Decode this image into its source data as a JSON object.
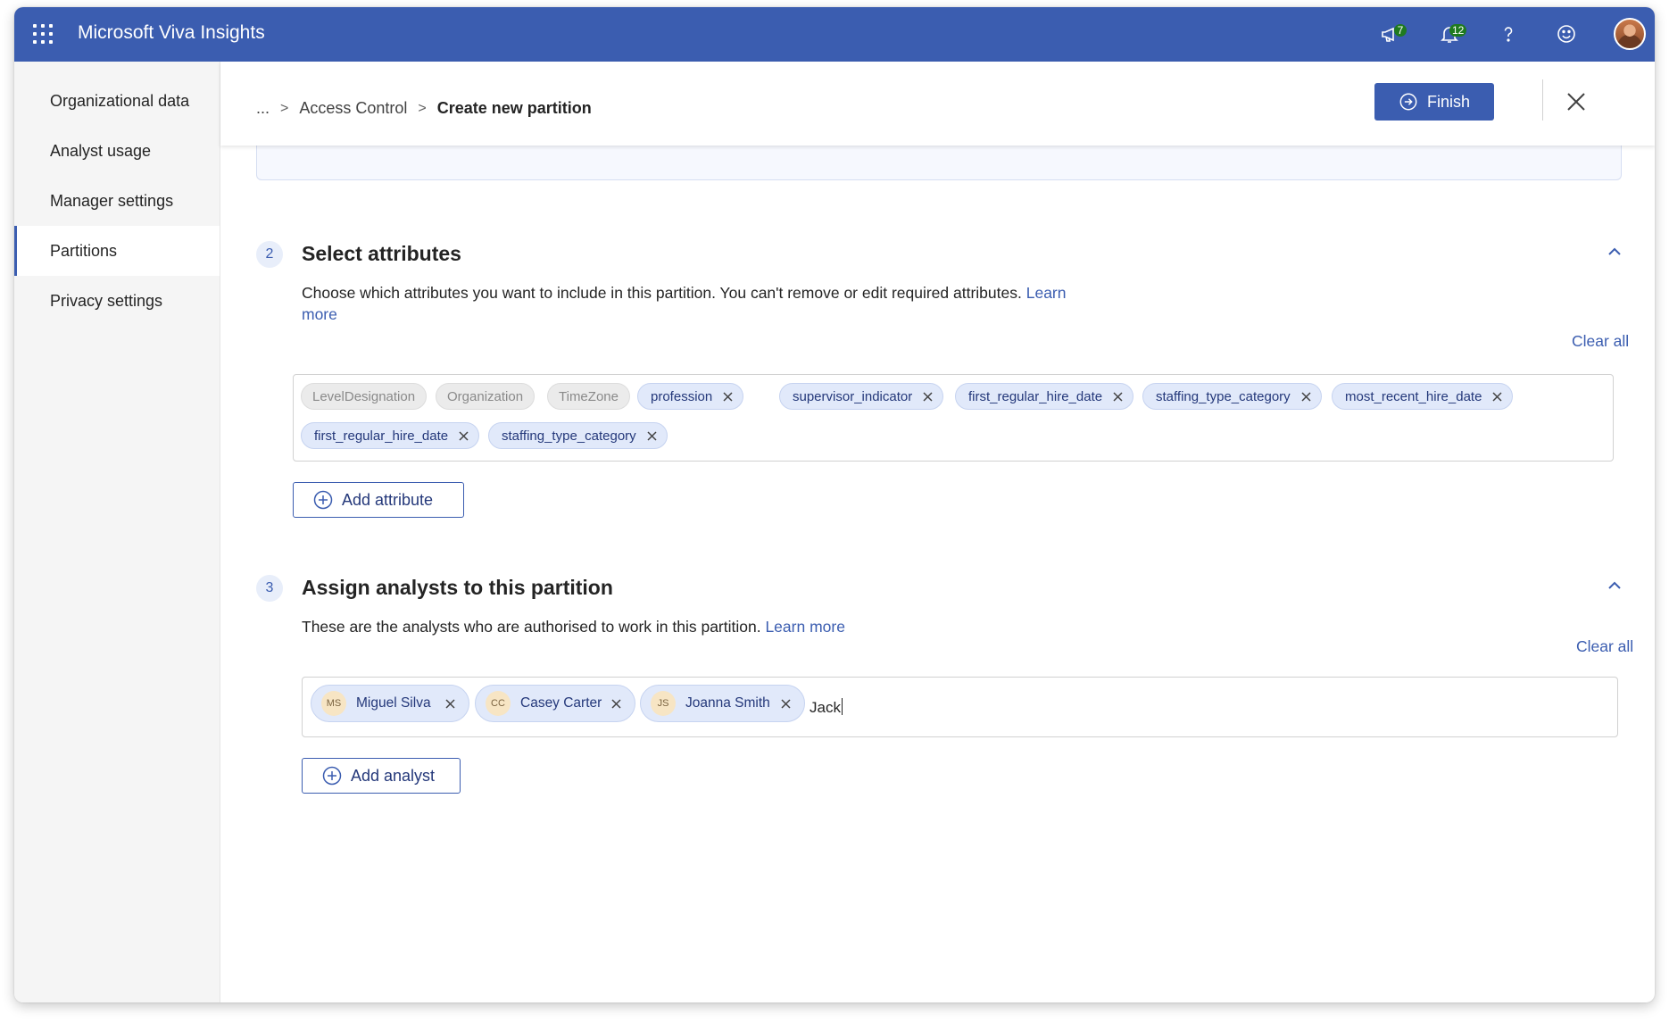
{
  "app": {
    "title": "Microsoft Viva Insights",
    "icons": {
      "waffle": "app-launcher-icon",
      "announcements": "megaphone-icon",
      "notifications": "bell-icon",
      "help": "help-icon",
      "feedback": "smiley-icon"
    },
    "announcements_count": "7",
    "notifications_count": "12",
    "brand_color": "#3b5db0"
  },
  "sidebar": {
    "items": [
      {
        "label": "Organizational data",
        "active": false
      },
      {
        "label": "Analyst usage",
        "active": false
      },
      {
        "label": "Manager settings",
        "active": false
      },
      {
        "label": "Partitions",
        "active": true
      },
      {
        "label": "Privacy settings",
        "active": false
      }
    ]
  },
  "header": {
    "breadcrumb": {
      "ellipsis": "...",
      "sep": ">",
      "parent": "Access Control",
      "current": "Create new partition"
    },
    "finish_label": "Finish"
  },
  "attributes_section": {
    "step": "2",
    "title": "Select attributes",
    "description": "Choose which attributes you want to include in this partition. You can't remove or edit required attributes.",
    "learn_more_1": "Learn",
    "learn_more_2": "more",
    "clear_all": "Clear all",
    "required_tags": [
      "LevelDesignation",
      "Organization",
      "TimeZone"
    ],
    "selected_tags": [
      "profession",
      "supervisor_indicator",
      "first_regular_hire_date",
      "staffing_type_category",
      "most_recent_hire_date",
      "first_regular_hire_date",
      "staffing_type_category"
    ],
    "add_label": "Add attribute"
  },
  "analysts_section": {
    "step": "3",
    "title": "Assign analysts to this partition",
    "description": "These are the analysts who are authorised to work in this partition.",
    "learn_more": "Learn more",
    "clear_all": "Clear all",
    "analysts": [
      {
        "initials": "MS",
        "name": "Miguel Silva"
      },
      {
        "initials": "CC",
        "name": "Casey Carter"
      },
      {
        "initials": "JS",
        "name": "Joanna Smith"
      }
    ],
    "typed_value": "Jack",
    "add_label": "Add analyst"
  }
}
